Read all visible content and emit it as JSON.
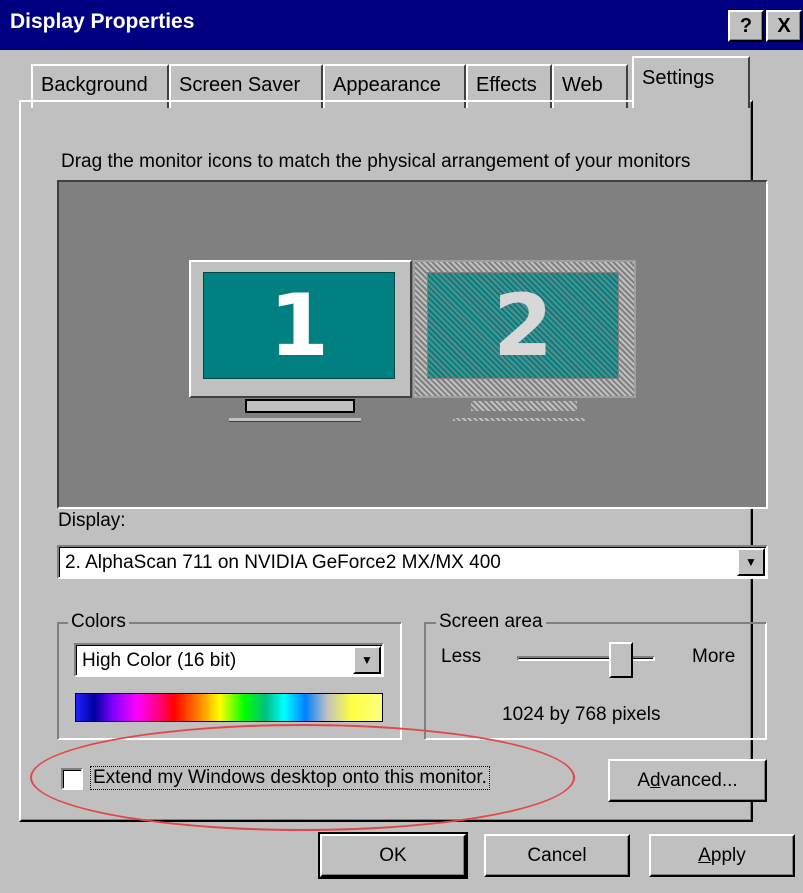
{
  "window": {
    "title": "Display Properties",
    "help_button": "?",
    "close_button": "X"
  },
  "tabs": [
    {
      "label": "Background",
      "active": false
    },
    {
      "label": "Screen Saver",
      "active": false
    },
    {
      "label": "Appearance",
      "active": false
    },
    {
      "label": "Effects",
      "active": false
    },
    {
      "label": "Web",
      "active": false
    },
    {
      "label": "Settings",
      "active": true
    }
  ],
  "settings": {
    "instruction": "Drag the monitor icons to match the physical arrangement of your monitors",
    "monitors": [
      {
        "number": "1",
        "selected": false
      },
      {
        "number": "2",
        "selected": true
      }
    ],
    "display_label": "Display:",
    "display_value": "2. AlphaScan 711 on NVIDIA GeForce2 MX/MX 400",
    "colors": {
      "group_label": "Colors",
      "value": "High Color (16 bit)"
    },
    "screen_area": {
      "group_label": "Screen area",
      "less_label": "Less",
      "more_label": "More",
      "resolution_text": "1024 by 768 pixels",
      "slider_fraction": 0.75
    },
    "extend_checkbox": {
      "label": "Extend my Windows desktop onto this monitor.",
      "checked": false
    },
    "advanced_button": {
      "prefix": "A",
      "accel": "d",
      "suffix": "vanced..."
    }
  },
  "footer": {
    "ok_label": "OK",
    "cancel_label": "Cancel",
    "apply_button": {
      "accel": "A",
      "suffix": "pply"
    }
  },
  "colors": {
    "titlebar": "#000080",
    "face": "#c0c0c0",
    "monitor_screen": "#008080",
    "annotation": "#e04848"
  }
}
